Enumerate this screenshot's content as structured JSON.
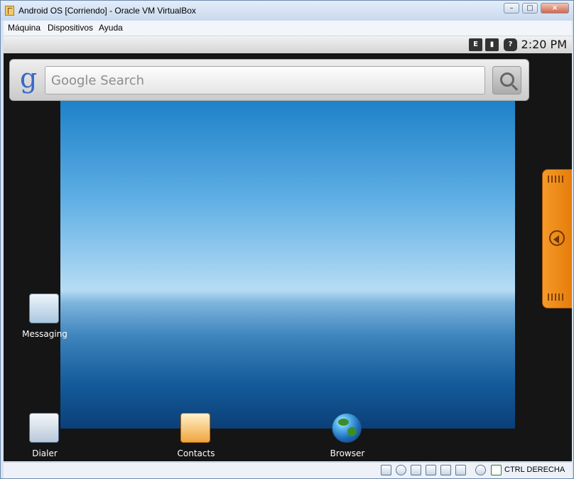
{
  "window": {
    "title": "Android OS [Corriendo] - Oracle VM VirtualBox",
    "controls": [
      "minimize",
      "maximize",
      "close"
    ]
  },
  "menubar": {
    "items": [
      "Máquina",
      "Dispositivos",
      "Ayuda"
    ]
  },
  "android": {
    "status": {
      "time": "2:20 PM",
      "icons": [
        "data-e-icon",
        "signal-icon",
        "unknown-icon"
      ]
    },
    "search": {
      "logo": "g",
      "placeholder": "Google Search"
    },
    "desktop_icons": [
      {
        "label": "Messaging",
        "icon": "messaging-icon"
      },
      {
        "label": "Dialer",
        "icon": "dialer-icon"
      },
      {
        "label": "Contacts",
        "icon": "contacts-icon"
      },
      {
        "label": "Browser",
        "icon": "browser-icon"
      }
    ]
  },
  "host_status": {
    "hostkey": "CTRL DERECHA",
    "icons": [
      "hard-disk-icon",
      "optical-drive-icon",
      "usb-icon",
      "network-icon",
      "shared-folder-icon",
      "screen-icon",
      "mouse-integration-icon",
      "host-key-icon"
    ]
  },
  "colors": {
    "drawer": "#f28a1a",
    "google_blue": "#3a67c7",
    "android_background": "#151515"
  }
}
